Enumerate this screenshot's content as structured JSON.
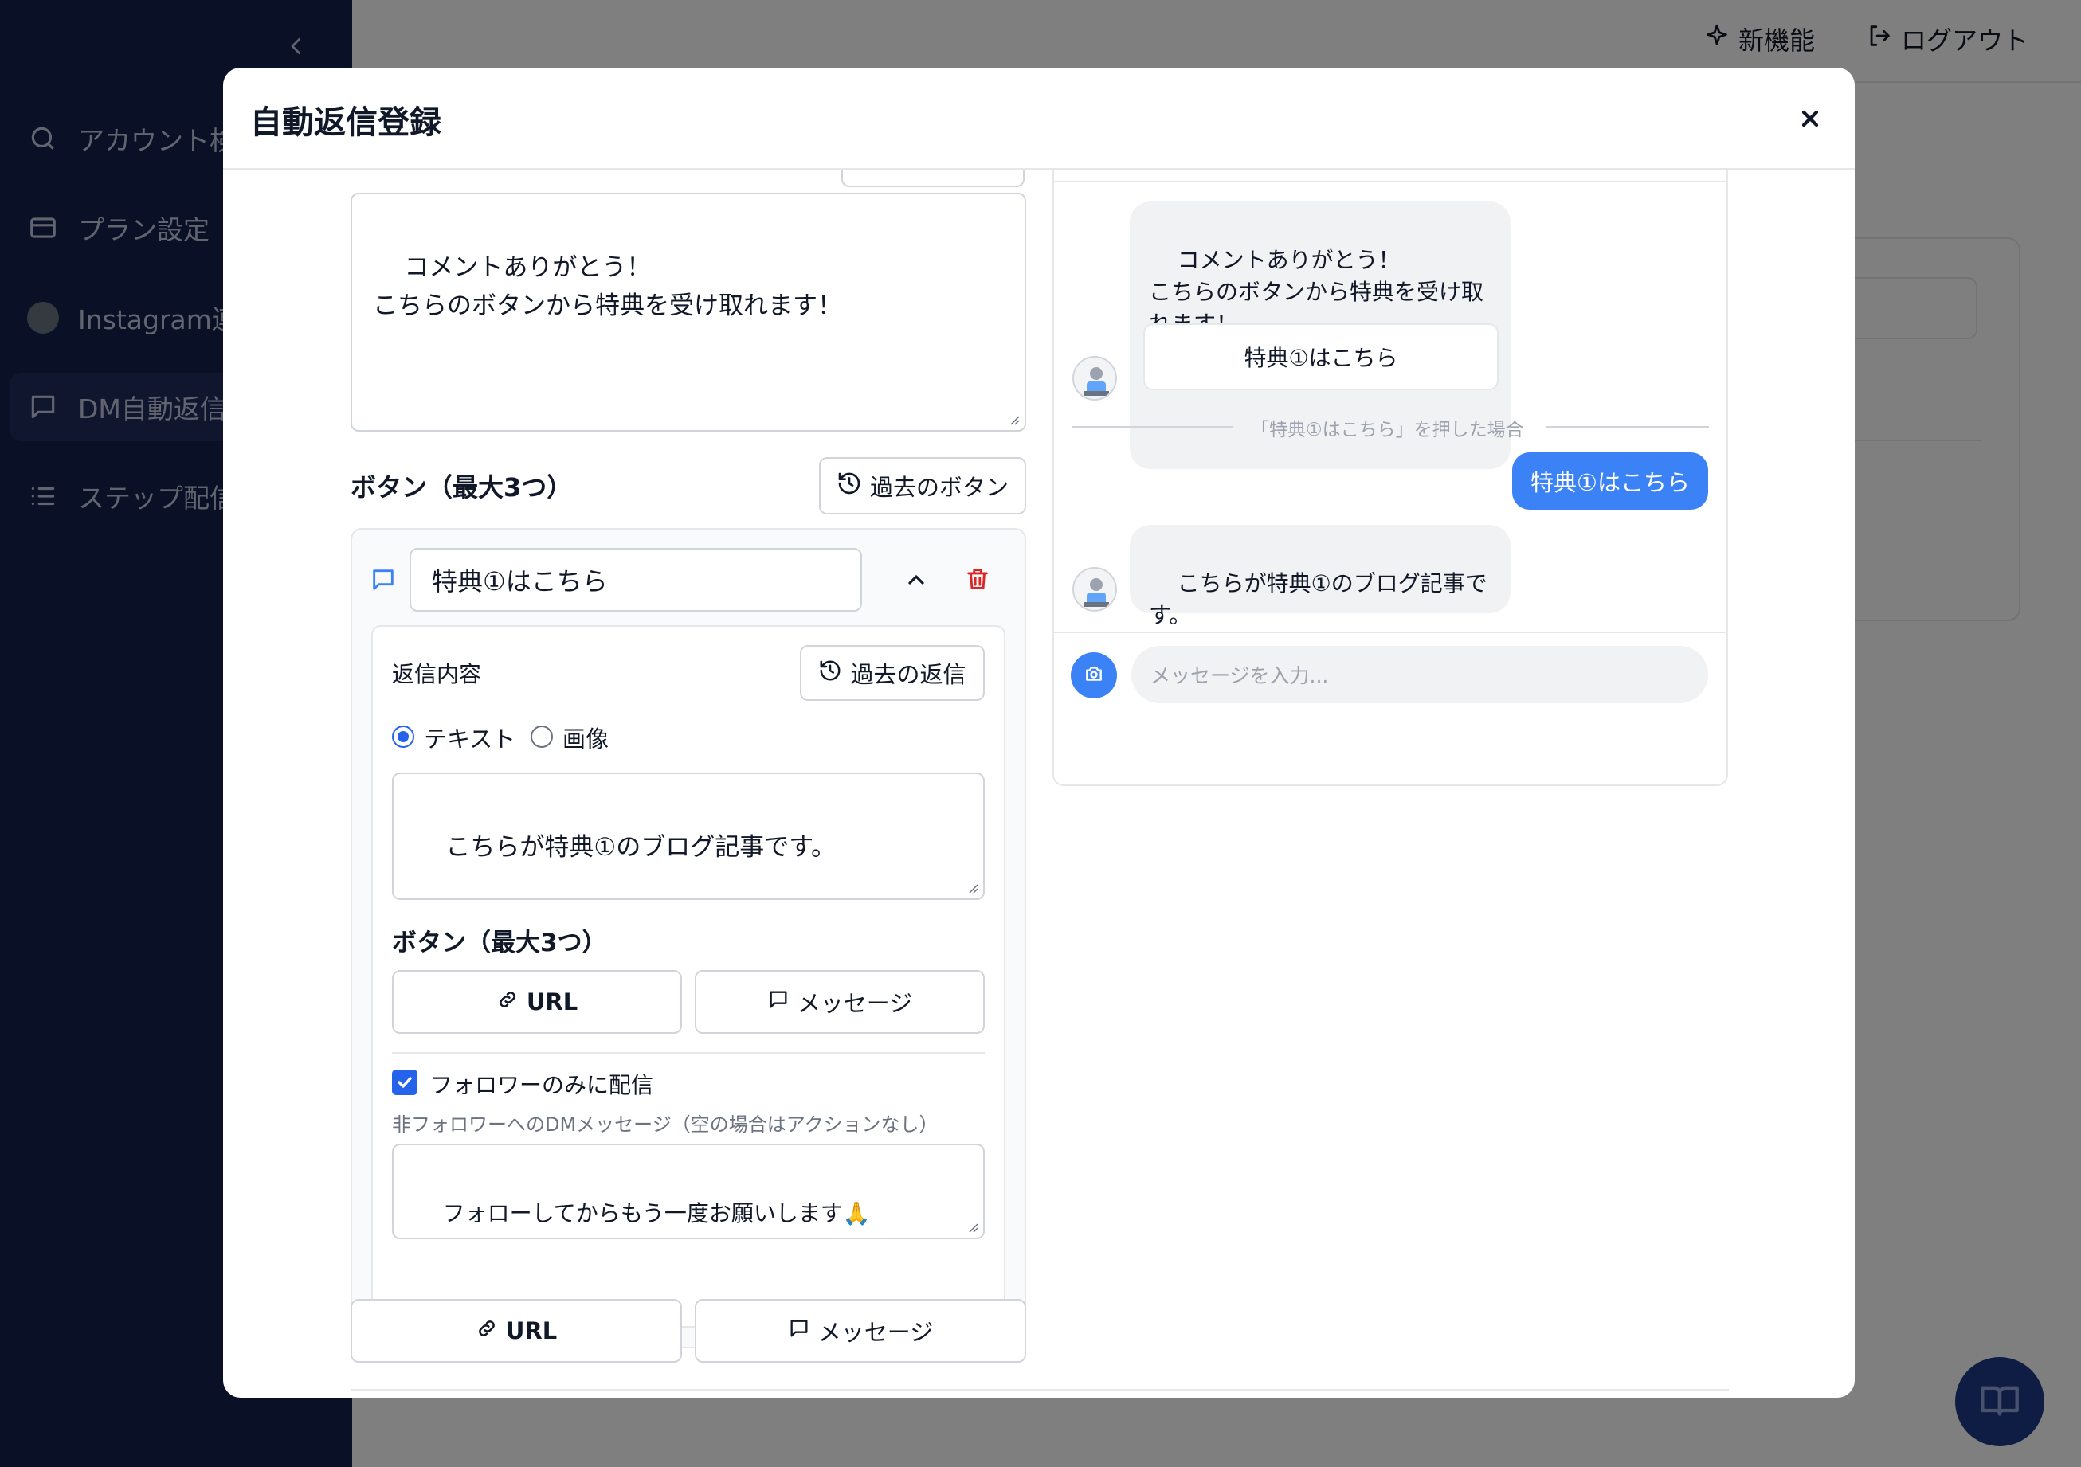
{
  "app": {
    "topbar": {
      "new_features": "新機能",
      "logout": "ログアウト"
    },
    "sidebar": {
      "items": [
        {
          "label": "アカウント検"
        },
        {
          "label": "プラン設定"
        },
        {
          "label": "Instagram連"
        },
        {
          "label": "DM自動返信"
        },
        {
          "label": "ステップ配信"
        }
      ]
    }
  },
  "modal": {
    "title": "自動返信登録",
    "comment_reply_text": "コメントありがとう！\nこちらのボタンから特典を受け取れます！",
    "buttons_section": {
      "title": "ボタン（最大3つ）",
      "past_buttons_label": "過去のボタン",
      "button": {
        "label_value": "特典①はこちら",
        "reply": {
          "title": "返信内容",
          "past_replies_label": "過去の返信",
          "type_options": [
            "テキスト",
            "画像"
          ],
          "selected_type": "テキスト",
          "text_value": "こちらが特典①のブログ記事です。",
          "nested_buttons_title": "ボタン（最大3つ）",
          "url_label": "URL",
          "message_label": "メッセージ",
          "followers_only_label": "フォロワーのみに配信",
          "followers_only_checked": true,
          "non_follower_label": "非フォロワーへのDMメッセージ（空の場合はアクションなし）",
          "non_follower_text": "フォローしてからもう一度お願いします🙏"
        }
      },
      "add_url_label": "URL",
      "add_message_label": "メッセージ"
    },
    "preview": {
      "first_message": "コメントありがとう！\nこちらのボタンから特典を受け取\nれます！",
      "first_message_button": "特典①はこちら",
      "separator_text": "「特典①はこちら」を押した場合",
      "user_reply": "特典①はこちら",
      "second_message": "こちらが特典①のブログ記事で\nす。",
      "input_placeholder": "メッセージを入力..."
    }
  },
  "colors": {
    "accent": "#3b82f6",
    "sidebar_bg": "#14204a",
    "danger": "#dc2626"
  }
}
